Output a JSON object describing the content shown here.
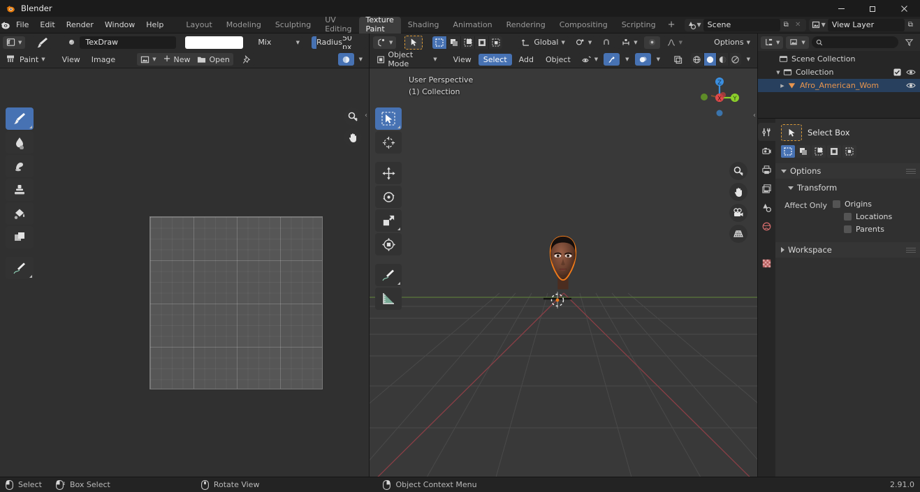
{
  "window": {
    "app_title": "Blender",
    "minimize": "–",
    "maximize": "❐",
    "close": "✕"
  },
  "topbar": {
    "menus": [
      "File",
      "Edit",
      "Render",
      "Window",
      "Help"
    ],
    "workspaces": [
      {
        "label": "Layout",
        "active": false
      },
      {
        "label": "Modeling",
        "active": false
      },
      {
        "label": "Sculpting",
        "active": false
      },
      {
        "label": "UV Editing",
        "active": false
      },
      {
        "label": "Texture Paint",
        "active": true
      },
      {
        "label": "Shading",
        "active": false
      },
      {
        "label": "Animation",
        "active": false
      },
      {
        "label": "Rendering",
        "active": false
      },
      {
        "label": "Compositing",
        "active": false
      },
      {
        "label": "Scripting",
        "active": false
      }
    ],
    "add_workspace": "+",
    "scene": {
      "name": "Scene",
      "new_btn": "⧉",
      "unlink_btn": "✕"
    },
    "view_layer": {
      "name": "View Layer",
      "new_btn": "⧉",
      "unlink_btn": "✕"
    }
  },
  "image_editor": {
    "header_top": {
      "editor_type": "image-editor-icon",
      "brush_icon": "brush-icon",
      "brush_name": "TexDraw",
      "color_value": "#ffffff",
      "blend_mode": "Mix",
      "radius_label": "Radius",
      "radius_value": "50 px"
    },
    "header_bottom": {
      "mode": "Paint",
      "menus": [
        "View",
        "Image"
      ],
      "new_label": "New",
      "open_label": "Open",
      "pin": "pin-icon"
    },
    "tools": [
      {
        "name": "draw",
        "icon": "brush-icon",
        "active": true
      },
      {
        "name": "soften",
        "icon": "droplet-icon",
        "active": false
      },
      {
        "name": "smear",
        "icon": "smear-icon",
        "active": false
      },
      {
        "name": "clone",
        "icon": "stamp-icon",
        "active": false
      },
      {
        "name": "fill",
        "icon": "bucket-icon",
        "active": false
      },
      {
        "name": "mask",
        "icon": "mask-icon",
        "active": false
      },
      {
        "name": "annotate",
        "icon": "pencil-icon",
        "active": false
      }
    ]
  },
  "viewport": {
    "header_top": {
      "editor_type": "viewport-icon",
      "transform_orientation": "Global",
      "options_label": "Options"
    },
    "header_bottom": {
      "mode": "Object Mode",
      "menus": [
        {
          "label": "View",
          "active": false
        },
        {
          "label": "Select",
          "active": true
        },
        {
          "label": "Add",
          "active": false
        },
        {
          "label": "Object",
          "active": false
        }
      ]
    },
    "overlay": {
      "perspective": "User Perspective",
      "collection": "(1) Collection"
    },
    "gizmo_axes": [
      {
        "label": "X",
        "color": "#e04a4a"
      },
      {
        "label": "Y",
        "color": "#8ccf2b"
      },
      {
        "label": "Z",
        "color": "#3b8fe0"
      }
    ],
    "tools": [
      {
        "name": "select-box",
        "active": true
      },
      {
        "name": "cursor",
        "active": false
      },
      {
        "name": "move",
        "active": false
      },
      {
        "name": "rotate",
        "active": false
      },
      {
        "name": "scale",
        "active": false
      },
      {
        "name": "transform",
        "active": false
      },
      {
        "name": "annotate",
        "active": false
      },
      {
        "name": "measure",
        "active": false
      }
    ],
    "nav_buttons": [
      "zoom-icon",
      "pan-hand-icon",
      "camera-icon",
      "ortho-grid-icon"
    ]
  },
  "outliner": {
    "search_placeholder": "",
    "rows": [
      {
        "label": "Scene Collection",
        "icon": "collection-icon",
        "indent": 0,
        "selected": false,
        "has_disclosure": false,
        "checkbox": false,
        "eye": false
      },
      {
        "label": "Collection",
        "icon": "collection-icon",
        "indent": 1,
        "selected": false,
        "has_disclosure": true,
        "checkbox": true,
        "eye": true
      },
      {
        "label": "Afro_American_Wom",
        "icon": "mesh-icon",
        "indent": 2,
        "selected": true,
        "has_disclosure": true,
        "checkbox": false,
        "eye": true
      }
    ]
  },
  "properties": {
    "tabs": [
      {
        "name": "tool",
        "active": true,
        "color": "#cfcfcf"
      },
      {
        "name": "render",
        "active": false,
        "color": "#cfcfcf"
      },
      {
        "name": "output",
        "active": false,
        "color": "#cfcfcf"
      },
      {
        "name": "view-layer",
        "active": false,
        "color": "#cfcfcf"
      },
      {
        "name": "scene",
        "active": false,
        "color": "#cfcfcf"
      },
      {
        "name": "world",
        "active": false,
        "color": "#d06a6a"
      },
      {
        "name": "texture",
        "active": false,
        "color": "#d06a6a"
      }
    ],
    "active_tool_name": "Select Box",
    "select_modes": [
      "set",
      "extend",
      "subtract",
      "invert",
      "intersect"
    ],
    "panels": {
      "options_label": "Options",
      "transform_label": "Transform",
      "affect_only_label": "Affect Only",
      "affect_only_items": [
        "Origins",
        "Locations",
        "Parents"
      ],
      "workspace_label": "Workspace"
    }
  },
  "statusbar": {
    "items": [
      {
        "icon": "mouse-left-icon",
        "label": "Select"
      },
      {
        "icon": "mouse-left-drag-icon",
        "label": "Box Select"
      },
      {
        "icon": "mouse-middle-icon",
        "label": "Rotate View"
      },
      {
        "icon": "mouse-right-icon",
        "label": "Object Context Menu"
      }
    ],
    "version": "2.91.0"
  }
}
